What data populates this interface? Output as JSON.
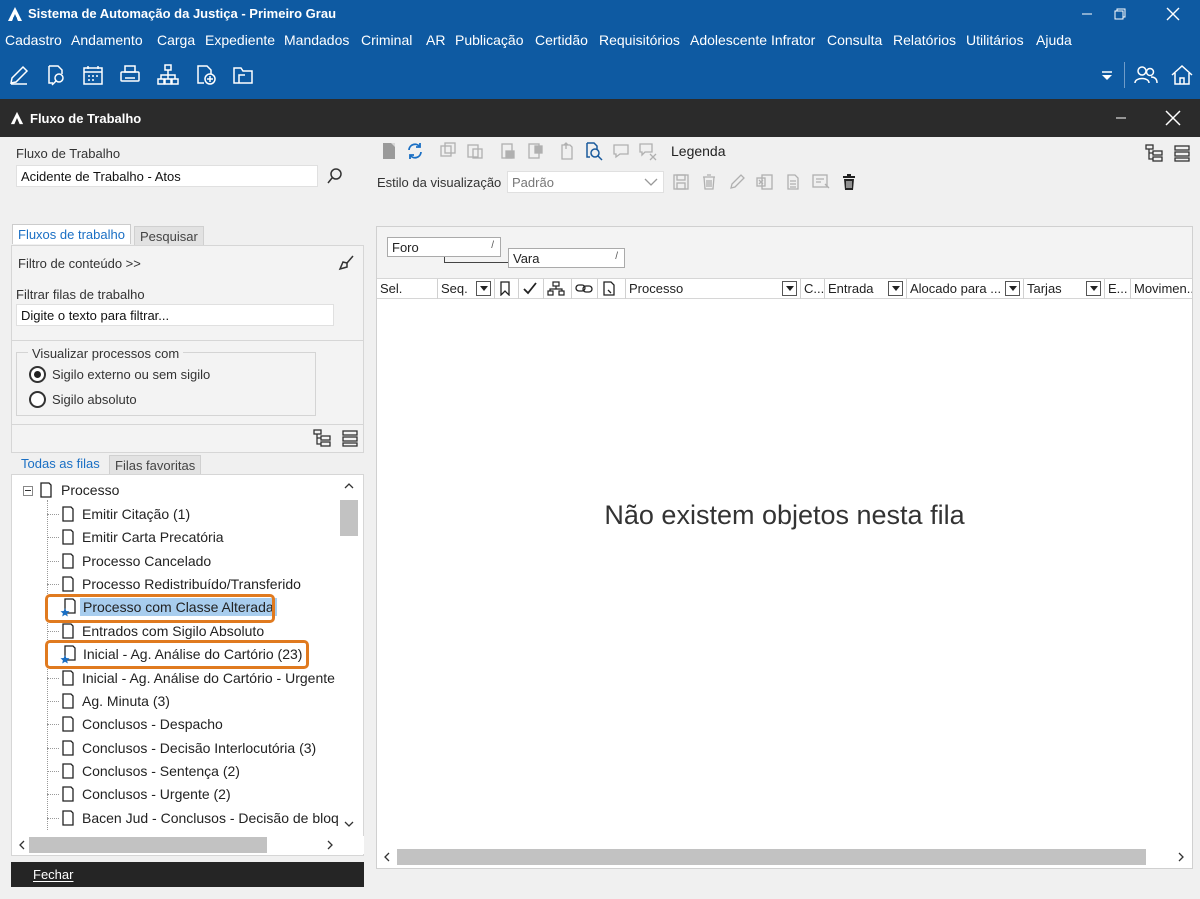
{
  "app": {
    "title": "Sistema de Automação da Justiça - Primeiro Grau",
    "menu": [
      "Cadastro",
      "Andamento",
      "Carga",
      "Expediente",
      "Mandados",
      "Criminal",
      "AR",
      "Publicação",
      "Certidão",
      "Requisitórios",
      "Adolescente Infrator",
      "Consulta",
      "Relatórios",
      "Utilitários",
      "Ajuda"
    ],
    "toolbar_icons": [
      "edit-icon",
      "search-document-icon",
      "calendar-icon",
      "printer-icon",
      "hierarchy-icon",
      "add-document-icon",
      "folder-icon"
    ]
  },
  "window": {
    "title": "Fluxo de Trabalho"
  },
  "left": {
    "fluxo_label": "Fluxo de Trabalho",
    "fluxo_value": "Acidente de Trabalho - Atos",
    "tabs": [
      "Fluxos de trabalho",
      "Pesquisar"
    ],
    "filtro_conteudo": "Filtro de conteúdo >>",
    "filtrar_label": "Filtrar filas de trabalho",
    "filtrar_placeholder": "Digite o texto para filtrar...",
    "visualizar_label": "Visualizar processos com",
    "radio1": "Sigilo externo ou sem sigilo",
    "radio2": "Sigilo absoluto",
    "tree_tabs": [
      "Todas as filas",
      "Filas favoritas"
    ],
    "tree_root": "Processo",
    "tree_items": [
      "Emitir Citação (1)",
      "Emitir Carta Precatória",
      "Processo Cancelado",
      "Processo Redistribuído/Transferido",
      "Processo com Classe Alterada",
      "Entrados com Sigilo Absoluto",
      "Inicial - Ag. Análise do Cartório (23)",
      "Inicial - Ag. Análise do Cartório - Urgente",
      "Ag. Minuta (3)",
      "Conclusos - Despacho",
      "Conclusos - Decisão Interlocutória (3)",
      "Conclusos - Sentença (2)",
      "Conclusos - Urgente (2)",
      "Bacen Jud - Conclusos - Decisão de bloqueio"
    ],
    "close_button": "Fechar"
  },
  "right": {
    "legenda": "Legenda",
    "estilo_label": "Estilo da visualização",
    "estilo_value": "Padrão",
    "group_foro": "Foro",
    "group_vara": "Vara",
    "columns": [
      "Sel.",
      "Seq.",
      "Processo",
      "C...",
      "Entrada",
      "Alocado para ...",
      "Tarjas",
      "E...",
      "Movimen..."
    ],
    "empty_message": "Não existem objetos nesta fila"
  }
}
